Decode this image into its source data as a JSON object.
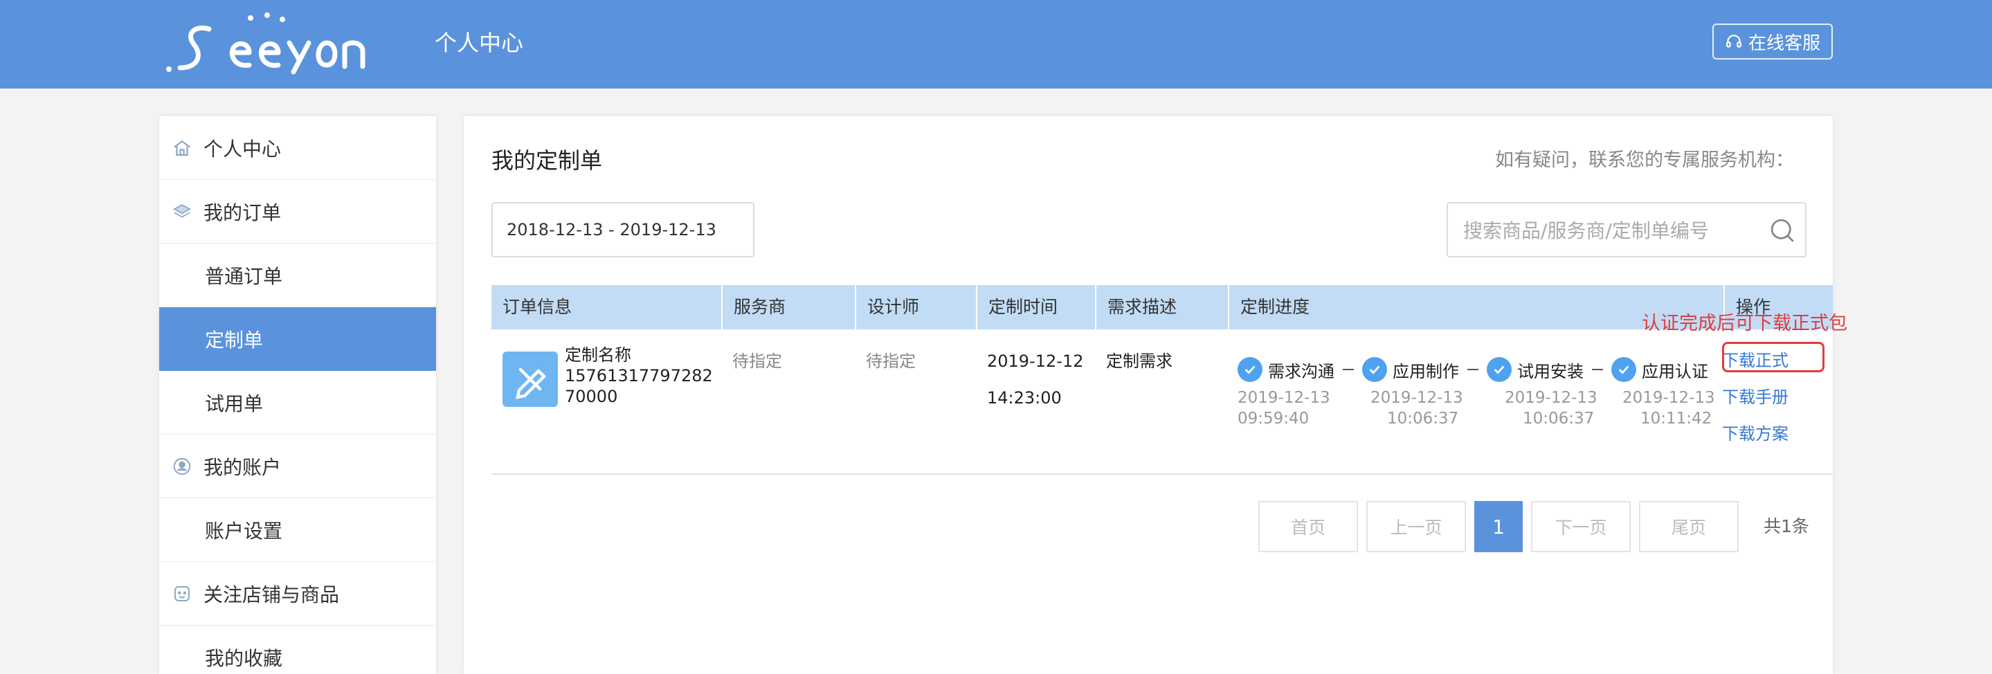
{
  "header": {
    "logo_text": "Seeyon",
    "title": "个人中心",
    "service_button": "在线客服",
    "bg_color": "#5a93dc"
  },
  "sidebar": {
    "items": [
      {
        "label": "个人中心",
        "type": "group",
        "icon": "home-icon"
      },
      {
        "label": "我的订单",
        "type": "group",
        "icon": "layers-icon"
      },
      {
        "label": "普通订单",
        "type": "sub"
      },
      {
        "label": "定制单",
        "type": "sub",
        "active": true
      },
      {
        "label": "试用单",
        "type": "sub"
      },
      {
        "label": "我的账户",
        "type": "group",
        "icon": "user-circle-icon"
      },
      {
        "label": "账户设置",
        "type": "sub"
      },
      {
        "label": "关注店铺与商品",
        "type": "group",
        "icon": "store-icon"
      },
      {
        "label": "我的收藏",
        "type": "sub"
      }
    ]
  },
  "main": {
    "title": "我的定制单",
    "contact_hint": "如有疑问，联系您的专属服务机构：",
    "date_range": "2018-12-13 - 2019-12-13",
    "search_placeholder": "搜索商品/服务商/定制单编号",
    "columns": [
      "订单信息",
      "服务商",
      "设计师",
      "定制时间",
      "需求描述",
      "定制进度",
      "操作"
    ],
    "order": {
      "name": "定制名称",
      "number": "1576131779728270000",
      "provider": "待指定",
      "designer": "待指定",
      "date": "2019-12-12",
      "time": "14:23:00",
      "description": "定制需求",
      "steps": [
        {
          "label": "需求沟通",
          "date": "2019-12-13",
          "time": "09:59:40"
        },
        {
          "label": "应用制作",
          "date": "2019-12-13",
          "time": "10:06:37"
        },
        {
          "label": "试用安装",
          "date": "2019-12-13",
          "time": "10:06:37"
        },
        {
          "label": "应用认证",
          "date": "2019-12-13",
          "time": "10:11:42"
        }
      ],
      "actions": [
        "下载正式",
        "下载手册",
        "下载方案"
      ]
    },
    "annotation": "认证完成后可下载正式包",
    "pagination": {
      "first": "首页",
      "prev": "上一页",
      "current": "1",
      "next": "下一页",
      "last": "尾页",
      "total": "共1条"
    }
  },
  "colors": {
    "accent": "#5a93dc",
    "table_header": "#c2dcf5",
    "link": "#3579d4",
    "annotation": "#e23b3b",
    "check": "#4ea2ef"
  }
}
